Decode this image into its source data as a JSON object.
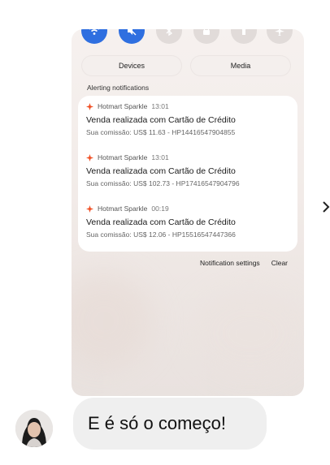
{
  "quick_settings": {
    "icons": [
      "wifi-icon",
      "mute-icon",
      "bluetooth-icon",
      "lock-icon",
      "flashlight-icon",
      "airplane-icon"
    ],
    "devices_label": "Devices",
    "media_label": "Media"
  },
  "notifications": {
    "section_label": "Alerting notifications",
    "items": [
      {
        "app": "Hotmart Sparkle",
        "time": "13:01",
        "title": "Venda realizada com Cartão de Crédito",
        "body": "Sua comissão: US$ 11.63 - HP14416547904855"
      },
      {
        "app": "Hotmart Sparkle",
        "time": "13:01",
        "title": "Venda realizada com Cartão de Crédito",
        "body": "Sua comissão: US$ 102.73 - HP17416547904796"
      },
      {
        "app": "Hotmart Sparkle",
        "time": "00:19",
        "title": "Venda realizada com Cartão de Crédito",
        "body": "Sua comissão: US$ 12.06 - HP15516547447366"
      }
    ],
    "settings_label": "Notification settings",
    "clear_label": "Clear"
  },
  "message": {
    "text": "E é só o começo!"
  },
  "colors": {
    "accent_blue": "#2f6fe0",
    "hotmart_orange": "#f04e23",
    "bubble_bg": "#efefef"
  }
}
